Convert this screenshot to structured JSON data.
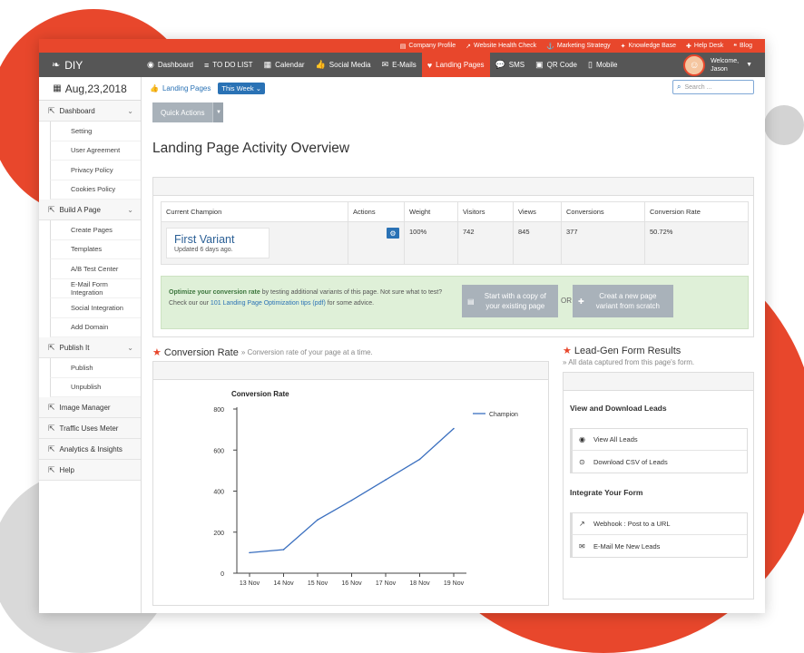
{
  "topbar": {
    "links": [
      {
        "icon": "file-icon",
        "glyph": "▤",
        "label": "Company Profile"
      },
      {
        "icon": "external-link-icon",
        "glyph": "↗",
        "label": "Website Health Check"
      },
      {
        "icon": "anchor-icon",
        "glyph": "⚓",
        "label": "Marketing Strategy"
      },
      {
        "icon": "lightbulb-icon",
        "glyph": "✦",
        "label": "Knowledge Base"
      },
      {
        "icon": "lifebuoy-icon",
        "glyph": "✚",
        "label": "Help Desk"
      },
      {
        "icon": "comments-icon",
        "glyph": "❝",
        "label": "Blog"
      }
    ]
  },
  "nav": {
    "brand": "DIY",
    "items": [
      {
        "icon": "dashboard-icon",
        "glyph": "◉",
        "label": "Dashboard",
        "active": false
      },
      {
        "icon": "list-icon",
        "glyph": "≡",
        "label": "TO DO LIST",
        "active": false
      },
      {
        "icon": "calendar-icon",
        "glyph": "▦",
        "label": "Calendar",
        "active": false
      },
      {
        "icon": "thumbs-up-icon",
        "glyph": "👍",
        "label": "Social Media",
        "active": false
      },
      {
        "icon": "envelope-icon",
        "glyph": "✉",
        "label": "E-Mails",
        "active": false
      },
      {
        "icon": "heart-icon",
        "glyph": "♥",
        "label": "Landing Pages",
        "active": true
      },
      {
        "icon": "comment-icon",
        "glyph": "💬",
        "label": "SMS",
        "active": false
      },
      {
        "icon": "qrcode-icon",
        "glyph": "▣",
        "label": "QR Code",
        "active": false
      },
      {
        "icon": "mobile-icon",
        "glyph": "▯",
        "label": "Mobile",
        "active": false
      }
    ],
    "welcome": "Welcome,",
    "username": "Jason"
  },
  "sidebar": {
    "date": "Aug,23,2018",
    "sections": [
      {
        "icon": "external-link-icon",
        "label": "Dashboard",
        "chevron": true,
        "children": [
          "Setting",
          "User Agreement",
          "Privacy Policy",
          "Cookies Policy"
        ]
      },
      {
        "icon": "external-link-icon",
        "label": "Build A Page",
        "chevron": true,
        "children": [
          "Create Pages",
          "Templates",
          "A/B Test Center",
          "E-Mail Form Integration",
          "Social Integration",
          "Add Domain"
        ]
      },
      {
        "icon": "external-link-icon",
        "label": "Publish It",
        "chevron": true,
        "children": [
          "Publish",
          "Unpublish"
        ]
      },
      {
        "icon": "external-link-icon",
        "label": "Image Manager",
        "chevron": false,
        "children": []
      },
      {
        "icon": "external-link-icon",
        "label": "Traffic Uses Meter",
        "chevron": false,
        "children": []
      },
      {
        "icon": "external-link-icon",
        "label": "Analytics & Insights",
        "chevron": false,
        "children": []
      },
      {
        "icon": "external-link-icon",
        "label": "Help",
        "chevron": false,
        "children": []
      }
    ]
  },
  "main": {
    "breadcrumb": "Landing Pages",
    "week_filter": "This Week",
    "search_placeholder": "Search ...",
    "quick_actions": "Quick Actions",
    "title": "Landing Page Activity Overview",
    "table": {
      "headers": [
        "Current Champion",
        "Actions",
        "Weight",
        "Visitors",
        "Views",
        "Conversions",
        "Conversion Rate"
      ],
      "champion_name": "First Variant",
      "champion_updated": "Updated 6 days ago.",
      "weight": "100%",
      "visitors": "742",
      "views": "845",
      "conversions": "377",
      "conversion_rate": "50.72%"
    },
    "tip": {
      "highlight": "Optimize your conversion rate",
      "text1": " by testing additional variants of this page. Not sure what to test? Check our our ",
      "link": "101 Landing Page Optimization tips (pdf)",
      "text2": " for some advice.",
      "btn_copy": "Start with a copy of your existing page",
      "or": "OR",
      "btn_new": "Creat a new page variant from scratch"
    },
    "conversion": {
      "title": "Conversion Rate",
      "subtitle": "» Conversion rate of your page at a time."
    },
    "leadgen": {
      "title": "Lead-Gen Form Results",
      "subtitle": "» All data captured from this page's form.",
      "view_heading": "View and Download Leads",
      "view_items": [
        {
          "icon": "eye-icon",
          "glyph": "◉",
          "label": "View All Leads"
        },
        {
          "icon": "download-icon",
          "glyph": "⊙",
          "label": "Download CSV of Leads"
        }
      ],
      "integrate_heading": "Integrate Your Form",
      "integrate_items": [
        {
          "icon": "external-link-icon",
          "glyph": "↗",
          "label": "Webhook : Post to a URL"
        },
        {
          "icon": "envelope-icon",
          "glyph": "✉",
          "label": "E-Mail Me New Leads"
        }
      ]
    }
  },
  "chart_data": {
    "type": "line",
    "title": "Conversion Rate",
    "categories": [
      "13 Nov",
      "14 Nov",
      "15 Nov",
      "16 Nov",
      "17 Nov",
      "18 Nov",
      "19 Nov"
    ],
    "series": [
      {
        "name": "Champion",
        "values": [
          100,
          115,
          260,
          355,
          455,
          555,
          705
        ]
      }
    ],
    "ylim": [
      0,
      800
    ],
    "yticks": [
      0,
      200,
      400,
      600,
      800
    ],
    "legend": "top-right",
    "color": "#3a6fbf"
  }
}
